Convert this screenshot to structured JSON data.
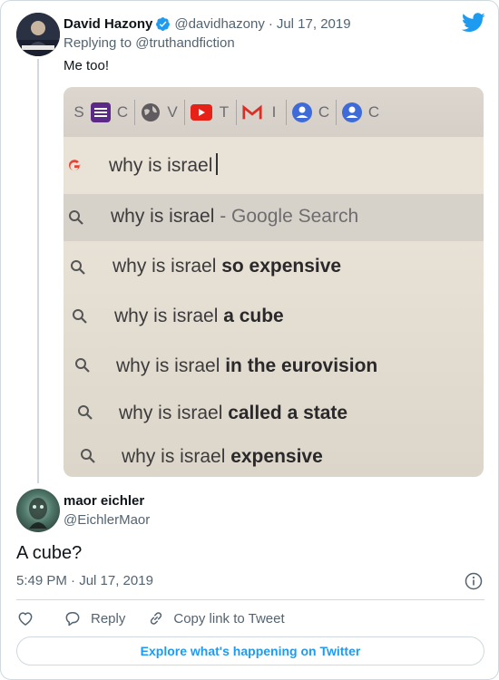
{
  "parent_tweet": {
    "author_name": "David Hazony",
    "handle": "@davidhazony",
    "separator": "·",
    "date": "Jul 17, 2019",
    "replying_prefix": "Replying to ",
    "replying_to": "@truthandfiction",
    "text": "Me too!",
    "verified": true
  },
  "screenshot": {
    "tab_glyphs": [
      "S",
      "C",
      "V",
      "T",
      "I",
      "C",
      "C"
    ],
    "query": "why is israel",
    "suggestions": [
      {
        "prefix": "why is israel",
        "suffix": " - Google Search",
        "bold": ""
      },
      {
        "prefix": "why is israel ",
        "suffix": "",
        "bold": "so expensive"
      },
      {
        "prefix": "why is israel ",
        "suffix": "",
        "bold": "a cube"
      },
      {
        "prefix": "why is israel ",
        "suffix": "",
        "bold": "in the eurovision"
      },
      {
        "prefix": "why is israel ",
        "suffix": "",
        "bold": "called a state"
      },
      {
        "prefix": "why is israel ",
        "suffix": "",
        "bold": "expensive"
      }
    ]
  },
  "tweet": {
    "author_name": "maor eichler",
    "handle": "@EichlerMaor",
    "text": "A cube?",
    "timestamp": "5:49 PM · Jul 17, 2019"
  },
  "actions": {
    "like_icon": "heart-icon",
    "reply_label": "Reply",
    "copy_label": "Copy link to Tweet"
  },
  "explore_label": "Explore what's happening on Twitter",
  "colors": {
    "accent": "#1d9bf0",
    "secondary_text": "#536471",
    "border": "#cfd9de"
  }
}
